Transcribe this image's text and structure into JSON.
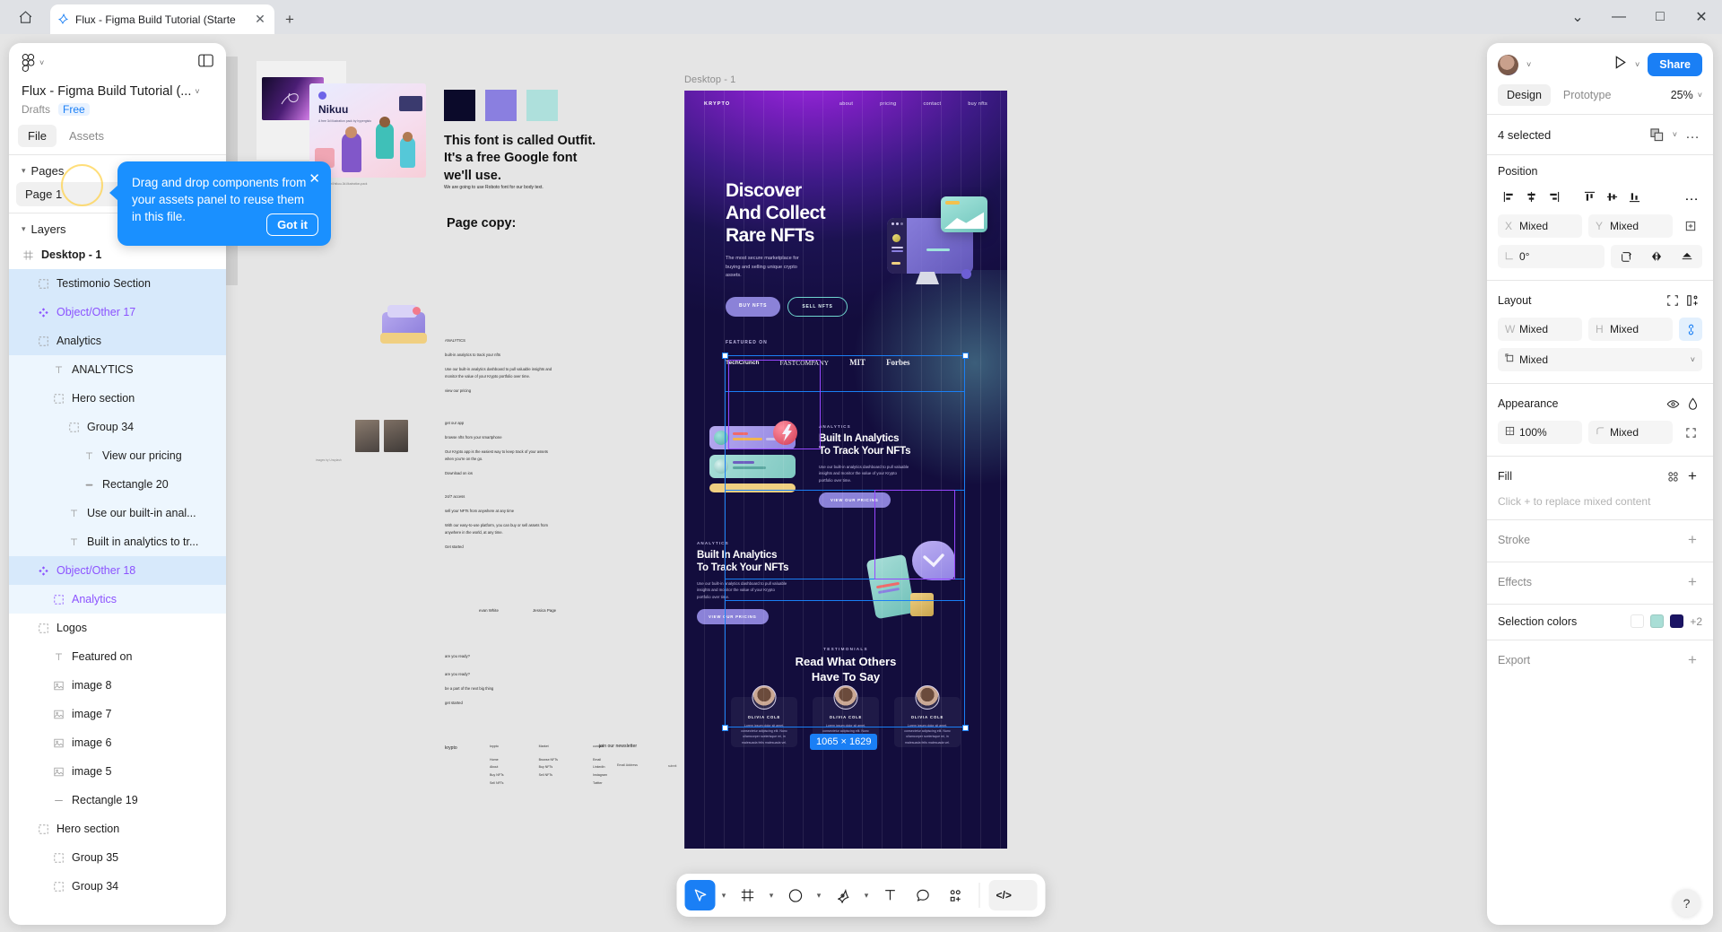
{
  "browser": {
    "home_icon": "home-icon",
    "tab": {
      "title": "Flux - Figma Build Tutorial (Starte",
      "favicon": "figma-icon",
      "close": "✕"
    },
    "new_tab": "+",
    "window_controls": {
      "minimize_group": "⌄",
      "minimize": "—",
      "maximize": "□",
      "close": "✕"
    }
  },
  "left_panel": {
    "menu_icon": "figma-menu-icon",
    "menu_caret": "˅",
    "sidebar_toggle_icon": "panel-toggle-icon",
    "file_title": "Flux - Figma Build Tutorial (...",
    "file_caret": "˅",
    "drafts": "Drafts",
    "plan": "Free",
    "tabs": [
      {
        "label": "File",
        "active": true
      },
      {
        "label": "Assets",
        "active": false
      }
    ],
    "pages_header": "Pages",
    "pages": [
      {
        "label": "Page 1",
        "active": true
      }
    ],
    "layers_header": "Layers",
    "layers": [
      {
        "label": "Desktop - 1",
        "icon": "frame-icon",
        "indent": 0,
        "state": "none",
        "bold": true,
        "purple": false
      },
      {
        "label": "Testimonio Section",
        "icon": "group-icon",
        "indent": 1,
        "state": "strong",
        "bold": false,
        "purple": false
      },
      {
        "label": "Object/Other 17",
        "icon": "component-icon",
        "indent": 1,
        "state": "strong",
        "bold": false,
        "purple": true
      },
      {
        "label": "Analytics",
        "icon": "group-icon",
        "indent": 1,
        "state": "strong",
        "bold": false,
        "purple": false
      },
      {
        "label": "ANALYTICS",
        "icon": "text-icon",
        "indent": 2,
        "state": "light",
        "bold": false,
        "purple": false
      },
      {
        "label": "Hero section",
        "icon": "group-icon",
        "indent": 2,
        "state": "light",
        "bold": false,
        "purple": false
      },
      {
        "label": "Group 34",
        "icon": "group-icon",
        "indent": 3,
        "state": "light",
        "bold": false,
        "purple": false
      },
      {
        "label": "View our pricing",
        "icon": "text-icon",
        "indent": 4,
        "state": "light",
        "bold": false,
        "purple": false
      },
      {
        "label": "Rectangle 20",
        "icon": "rect-icon",
        "indent": 4,
        "state": "light",
        "bold": false,
        "purple": false
      },
      {
        "label": "Use our built-in anal...",
        "icon": "text-icon",
        "indent": 3,
        "state": "light",
        "bold": false,
        "purple": false
      },
      {
        "label": "Built in analytics to tr...",
        "icon": "text-icon",
        "indent": 3,
        "state": "light",
        "bold": false,
        "purple": false
      },
      {
        "label": "Object/Other 18",
        "icon": "component-icon",
        "indent": 1,
        "state": "strong",
        "bold": false,
        "purple": true
      },
      {
        "label": "Analytics",
        "icon": "group-icon",
        "indent": 2,
        "state": "light",
        "bold": false,
        "purple": true
      },
      {
        "label": "Logos",
        "icon": "group-icon",
        "indent": 1,
        "state": "none",
        "bold": false,
        "purple": false
      },
      {
        "label": "Featured on",
        "icon": "text-icon",
        "indent": 2,
        "state": "none",
        "bold": false,
        "purple": false
      },
      {
        "label": "image 8",
        "icon": "image-icon",
        "indent": 2,
        "state": "none",
        "bold": false,
        "purple": false
      },
      {
        "label": "image 7",
        "icon": "image-icon",
        "indent": 2,
        "state": "none",
        "bold": false,
        "purple": false
      },
      {
        "label": "image 6",
        "icon": "image-icon",
        "indent": 2,
        "state": "none",
        "bold": false,
        "purple": false
      },
      {
        "label": "image 5",
        "icon": "image-icon",
        "indent": 2,
        "state": "none",
        "bold": false,
        "purple": false
      },
      {
        "label": "Rectangle 19",
        "icon": "line-icon",
        "indent": 2,
        "state": "none",
        "bold": false,
        "purple": false
      },
      {
        "label": "Hero section",
        "icon": "group-icon",
        "indent": 1,
        "state": "none",
        "bold": false,
        "purple": false
      },
      {
        "label": "Group 35",
        "icon": "group-icon",
        "indent": 2,
        "state": "none",
        "bold": false,
        "purple": false
      },
      {
        "label": "Group 34",
        "icon": "group-icon",
        "indent": 2,
        "state": "none",
        "bold": false,
        "purple": false
      }
    ]
  },
  "tooltip": {
    "text": "Drag and drop components from your assets panel to reuse them in this file.",
    "button": "Got it",
    "close": "✕"
  },
  "right_panel": {
    "avatar": "avatar",
    "avatar_caret": "˅",
    "present_icon": "play-icon",
    "present_caret": "˅",
    "share_label": "Share",
    "tabs": [
      {
        "label": "Design",
        "active": true
      },
      {
        "label": "Prototype",
        "active": false
      }
    ],
    "zoom": "25%",
    "zoom_caret": "˅",
    "selection_label": "4 selected",
    "selection_component_icon": "component-copy-icon",
    "selection_caret": "˅",
    "selection_more": "…",
    "position": {
      "title": "Position",
      "align_more": "…",
      "x_label": "X",
      "x_value": "Mixed",
      "y_label": "Y",
      "y_value": "Mixed",
      "rotation_label": "rotation-icon",
      "rotation_value": "0°"
    },
    "layout": {
      "title": "Layout",
      "w_label": "W",
      "w_value": "Mixed",
      "h_label": "H",
      "h_value": "Mixed",
      "constraint_value": "Mixed",
      "constraint_caret": "˅"
    },
    "appearance": {
      "title": "Appearance",
      "opacity_value": "100%",
      "corner_value": "Mixed"
    },
    "fill": {
      "title": "Fill",
      "empty_text": "Click + to replace mixed content",
      "add": "+"
    },
    "stroke": {
      "title": "Stroke",
      "add": "+"
    },
    "effects": {
      "title": "Effects",
      "add": "+"
    },
    "selection_colors": {
      "title": "Selection colors",
      "swatches": [
        "#ffffff",
        "#a9ded6",
        "#1b1464"
      ],
      "more": "+2"
    },
    "export": {
      "title": "Export",
      "add": "+"
    }
  },
  "toolbar": {
    "tools": [
      {
        "name": "move-tool",
        "glyph": "➤",
        "active": true,
        "caret": true
      },
      {
        "name": "frame-tool",
        "glyph": "#",
        "active": false,
        "caret": true
      },
      {
        "name": "shape-tool",
        "glyph": "○",
        "active": false,
        "caret": true
      },
      {
        "name": "pen-tool",
        "glyph": "✎",
        "active": false,
        "caret": true
      },
      {
        "name": "text-tool",
        "glyph": "T",
        "active": false,
        "caret": false
      },
      {
        "name": "comment-tool",
        "glyph": "◯",
        "active": false,
        "caret": false
      },
      {
        "name": "actions-tool",
        "glyph": "∴",
        "active": false,
        "caret": false
      }
    ],
    "dev_mode": "</>",
    "help": "?"
  },
  "canvas": {
    "frame_label": "Desktop - 1",
    "size_badge": "1065 × 1629",
    "mockup": {
      "brand": "KRYPTO",
      "nav_links": [
        "about",
        "pricing",
        "contact",
        "buy nfts"
      ],
      "hero_title_lines": [
        "Discover",
        "And Collect",
        "Rare NFTs"
      ],
      "hero_sub": "The most secure marketplace for buying and selling unique crypto assets.",
      "hero_btn_primary": "BUY NFTS",
      "hero_btn_secondary": "SELL NFTS",
      "featured_label": "FEATURED ON",
      "featured_logos": [
        "TechCrunch",
        "FASTCOMPANY",
        "MIT",
        "Forbes"
      ],
      "analytics_kicker": "ANALYTICS",
      "analytics_title_lines": [
        "Built In Analytics",
        "To Track Your NFTs"
      ],
      "analytics_body": "Use our built-in analytics dashboard to pull valuable insights and monitor the value of your Krypto portfolio over time.",
      "analytics_btn": "VIEW OUR PRICING",
      "testimonials_kicker": "TESTIMONIALS",
      "testimonials_title_lines": [
        "Read What Others",
        "Have To Say"
      ],
      "testimonial_name": "OLIVIA COLE",
      "testimonial_text": "Lorem ipsum dolor sit amet, consectetur adipiscing elit. Nunc ullamcorper scelerisque mi, in malesuada felis malesuada vel."
    },
    "notes": {
      "font_note_lines": [
        "This font is called Outfit.",
        "It's a free Google font",
        "we'll use."
      ],
      "body_note": "We are going to use Roboto font for our body text.",
      "page_copy_heading": "Page copy:",
      "swatches": [
        "#0b0a2a",
        "#8a7fe0",
        "#aee0dc"
      ],
      "copy_blocks": [
        {
          "lines": [
            "ANALYTICS",
            "built-in analytics to track your nfts",
            "Use our built-in analytics dashboard to pull valuable insights and monitor the value of your Krypto portfolio over time.",
            "view our pricing"
          ]
        },
        {
          "lines": [
            "get our app",
            "browse nfts from your smartphone",
            "Our Krypto app is the easiest way to keep track of your assets when you're on the go.",
            "Download on ios"
          ]
        },
        {
          "lines": [
            "24/7 access",
            "sell your NFTs from anywhere at any time",
            "With our easy-to-use platform, you can buy or sell assets from anywhere in the world, at any time.",
            "Get started"
          ]
        },
        {
          "lines": [
            "evan White",
            "Jessica Page"
          ]
        },
        {
          "lines": [
            "are you ready?",
            "are you ready?",
            "be a part of the next big thing",
            "get started"
          ]
        }
      ],
      "footer": {
        "brand": "krypto",
        "columns": [
          {
            "title": "krypto",
            "items": [
              "Home",
              "About",
              "Buy NFTs",
              "Sell NFTs"
            ]
          },
          {
            "title": "Market",
            "items": [
              "Browse NFTs",
              "Buy NFTs",
              "Sell NFTs"
            ]
          },
          {
            "title": "contact",
            "items": [
              "Email",
              "LinkedIn",
              "Instagram",
              "Twitter"
            ]
          }
        ],
        "newsletter_title": "join our newsletter",
        "newsletter_placeholder": "Email Address",
        "newsletter_submit": "submit"
      },
      "nikuu_card": {
        "title": "Nikuu",
        "subtitle": "A free 3d illustration pack by hypergisto"
      }
    }
  }
}
